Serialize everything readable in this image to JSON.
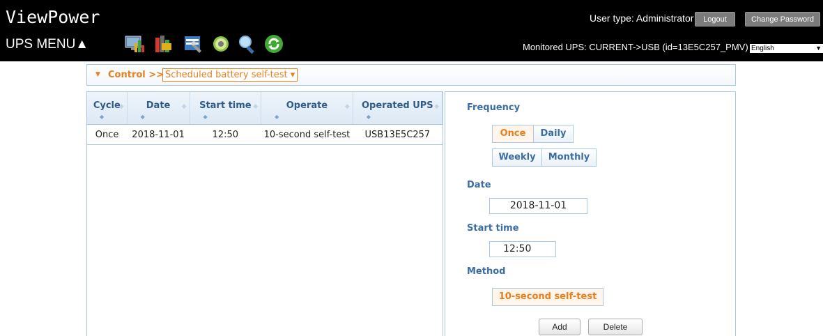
{
  "header": {
    "app_title": "ViewPower",
    "ups_menu_label": "UPS MENU▲",
    "user_type": "User type: Administrator",
    "logout_label": "Logout",
    "change_password_label": "Change Password",
    "monitored_ups": "Monitored UPS: CURRENT->USB (id=13E5C257_PMV)",
    "language": "English",
    "toolbar_icons": [
      "monitor-icon",
      "battery-icon",
      "configuration-icon",
      "settings-gear-icon",
      "search-icon",
      "refresh-icon"
    ]
  },
  "breadcrumb": {
    "section": "Control >>",
    "selected_page": "Scheduled battery self-test ▾"
  },
  "table": {
    "columns": [
      "Cycle",
      "Date",
      "Start time",
      "Operate",
      "Operated UPS"
    ],
    "rows": [
      [
        "Once",
        "2018-11-01",
        "12:50",
        "10-second self-test",
        "USB13E5C257"
      ]
    ]
  },
  "form": {
    "frequency_label": "Frequency",
    "frequency_options": [
      "Once",
      "Daily",
      "Weekly",
      "Monthly"
    ],
    "frequency_selected": "Once",
    "date_label": "Date",
    "date_value": "2018-11-01",
    "start_time_label": "Start time",
    "start_time_value": "12:50",
    "method_label": "Method",
    "method_value": "10-second self-test",
    "add_label": "Add",
    "delete_label": "Delete"
  },
  "colors": {
    "accent_orange": "#e87f1e",
    "header_blue": "#3a6da3",
    "border_blue": "#a9c8e4",
    "topbar_black": "#000000"
  }
}
